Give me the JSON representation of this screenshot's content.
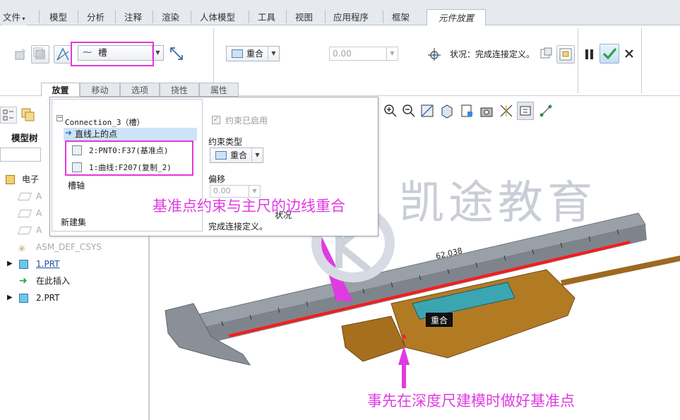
{
  "ribbon": {
    "tabs": [
      {
        "label": "文件"
      },
      {
        "label": "模型"
      },
      {
        "label": "分析"
      },
      {
        "label": "注释"
      },
      {
        "label": "渲染"
      },
      {
        "label": "人体模型"
      },
      {
        "label": "工具"
      },
      {
        "label": "视图"
      },
      {
        "label": "应用程序"
      },
      {
        "label": "框架"
      }
    ],
    "active_tab": "元件放置",
    "connection_type": "槽",
    "constraint_type": "重合",
    "offset_value": "0.00",
    "status_label": "状况：完成连接定义。"
  },
  "subtabs": [
    {
      "label": "放置"
    },
    {
      "label": "移动"
    },
    {
      "label": "选项"
    },
    {
      "label": "挠性"
    },
    {
      "label": "属性"
    }
  ],
  "left_panel": {
    "title": "模型树",
    "items": [
      {
        "label": "电子"
      },
      {
        "label": "A"
      },
      {
        "label": "A"
      },
      {
        "label": "A"
      },
      {
        "label": "ASM_DEF_CSYS"
      },
      {
        "label": "1.PRT"
      },
      {
        "label": "在此插入"
      },
      {
        "label": "2.PRT"
      }
    ]
  },
  "placement": {
    "connection_name": "Connection_3（槽）",
    "item_point_on_line": "直线上的点",
    "ref1": "2:PNT0:F37(基准点)",
    "ref2": "1:曲线:F207(复制_2)",
    "slot_axis": "槽轴",
    "new_set": "新建集",
    "constraint_enabled": "约束已启用",
    "constraint_type_label": "约束类型",
    "constraint_type": "重合",
    "offset_label": "偏移",
    "offset_value": "0.00",
    "status_label": "状况",
    "status_text": "完成连接定义。"
  },
  "viewport": {
    "coincide_label": "重合",
    "dimension": "62.038"
  },
  "annotations": {
    "top": "基准点约束与主尺的边线重合",
    "bottom": "事先在深度尺建模时做好基准点",
    "watermark": "凯途教育"
  },
  "colors": {
    "annotation": "#e03be2",
    "red_line": "#ff1a1a",
    "scale": "#8d9298",
    "slider": "#b37a24"
  }
}
